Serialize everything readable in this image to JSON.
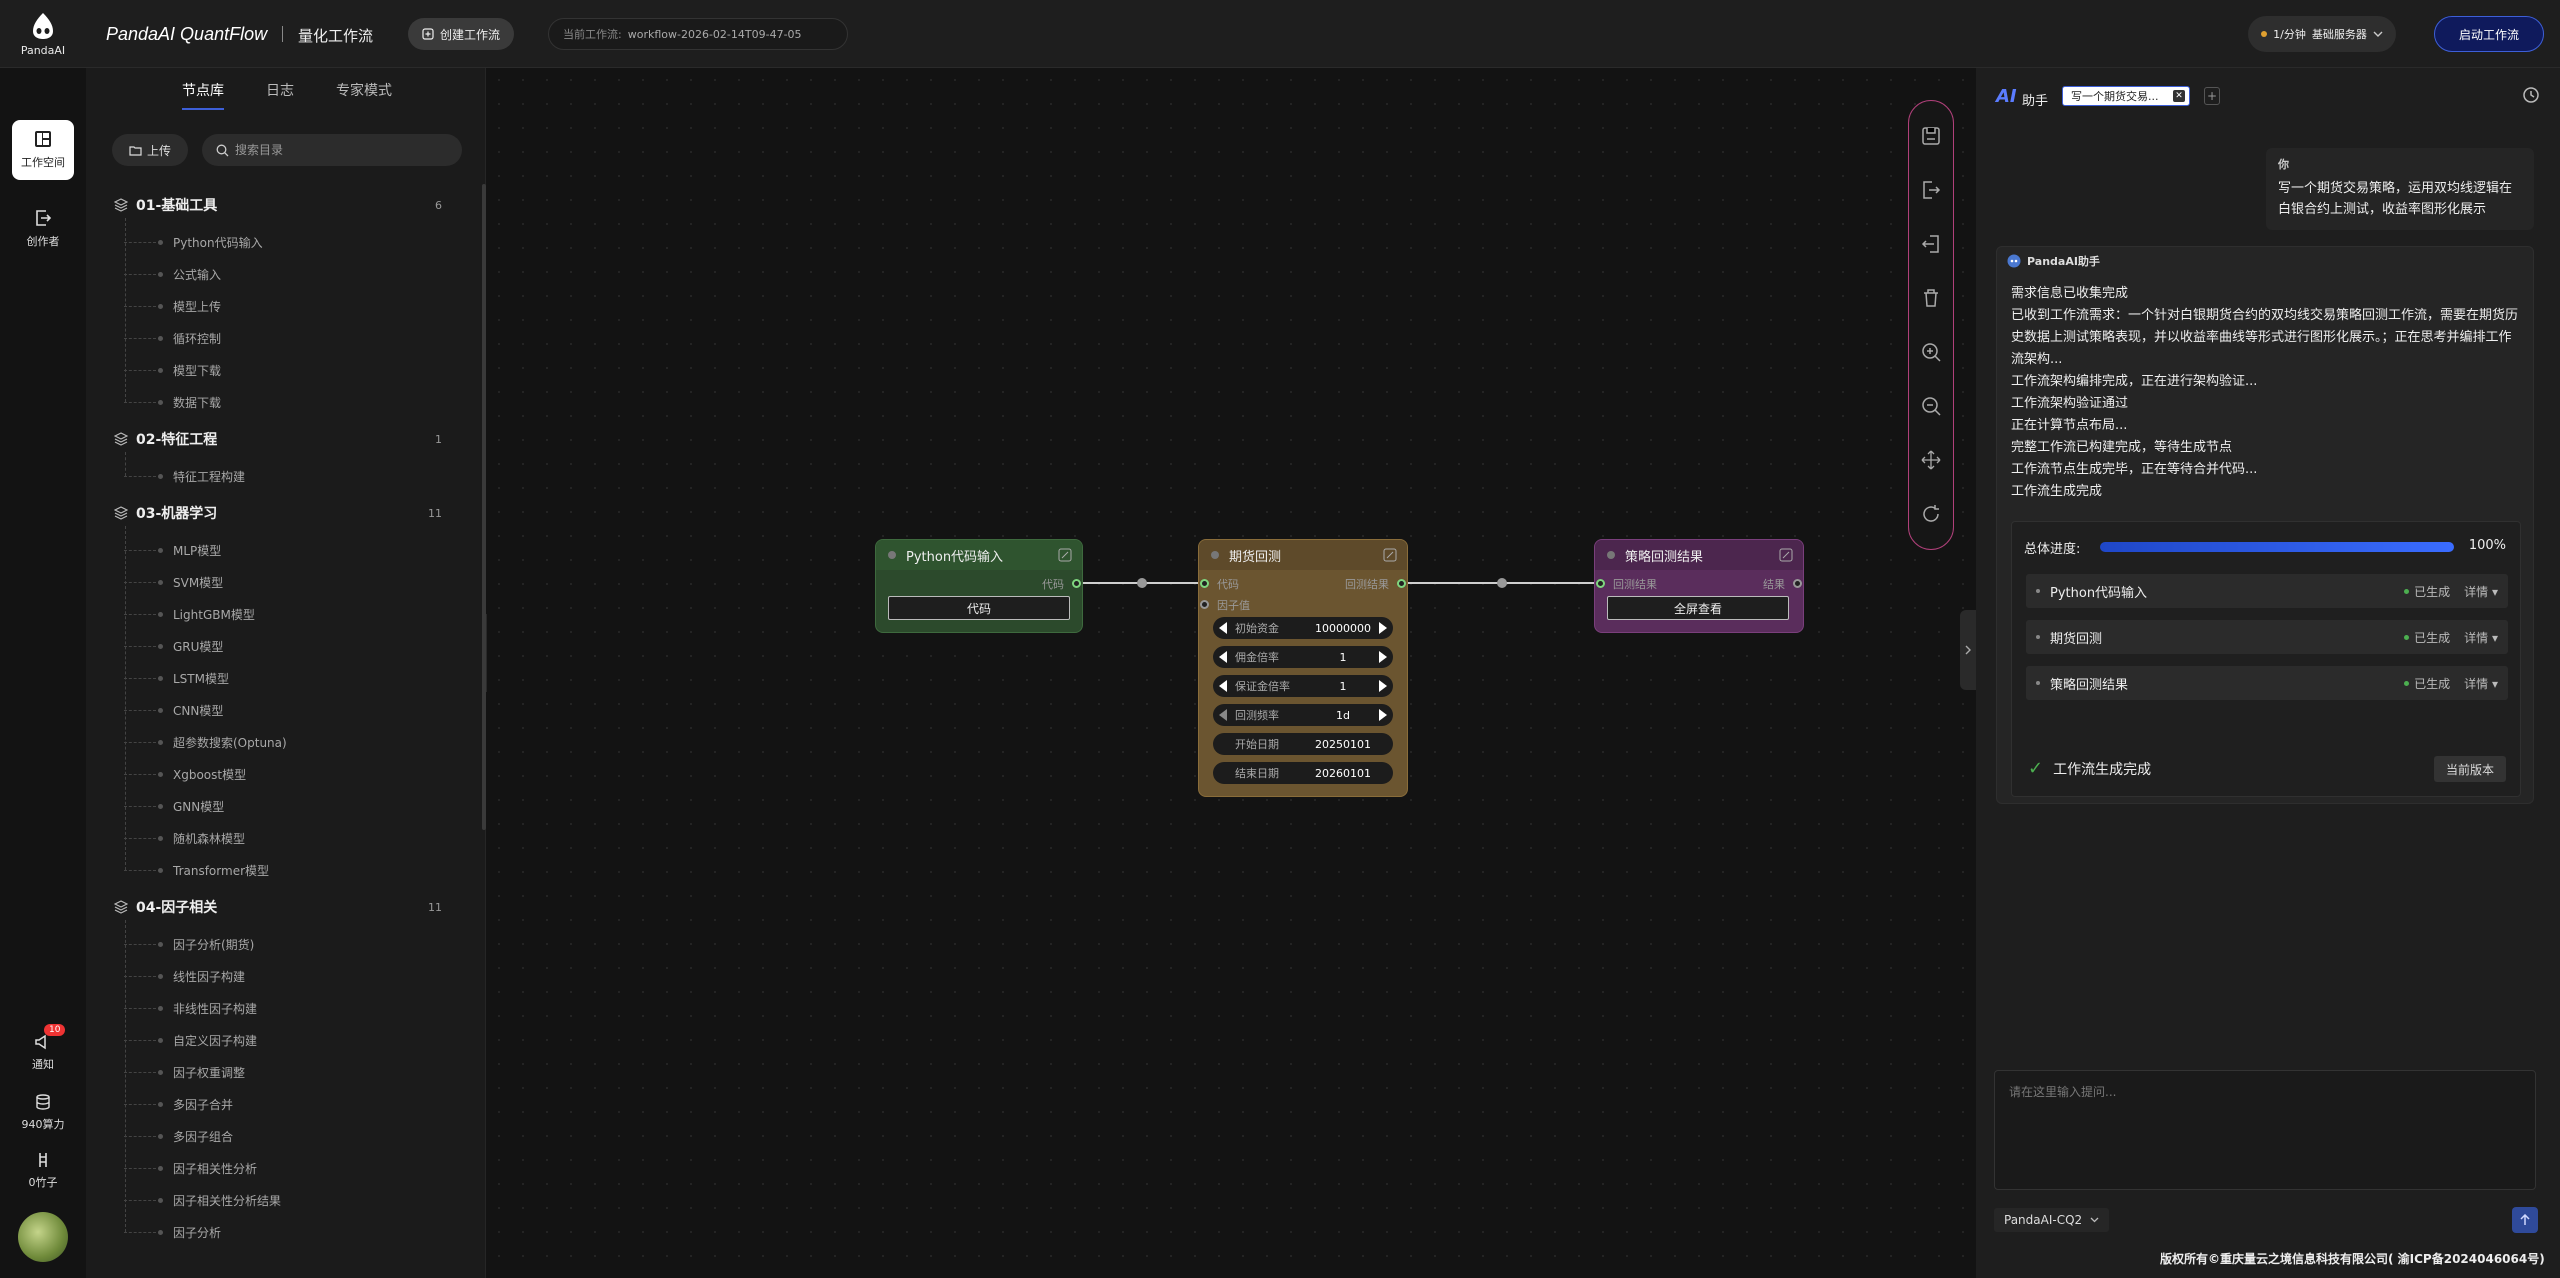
{
  "header": {
    "logo_label": "PandaAI",
    "app_title": "PandaAI QuantFlow",
    "app_subtitle": "量化工作流",
    "create_button": "创建工作流",
    "current_workflow_label": "当前工作流:",
    "current_workflow_value": "workflow-2026-02-14T09-47-05",
    "server_rate": "1/分钟",
    "server_name": "基础服务器",
    "start_button": "启动工作流"
  },
  "rail": {
    "workspace": "工作空间",
    "creator": "创作者",
    "notify": "通知",
    "notify_badge": "10",
    "compute": "940算力",
    "bamboo": "0竹子"
  },
  "library": {
    "tabs": [
      "节点库",
      "日志",
      "专家模式"
    ],
    "upload_label": "上传",
    "search_placeholder": "搜索目录",
    "categories": [
      {
        "name": "01-基础工具",
        "count": "6",
        "items": [
          "Python代码输入",
          "公式输入",
          "模型上传",
          "循环控制",
          "模型下载",
          "数据下载"
        ]
      },
      {
        "name": "02-特征工程",
        "count": "1",
        "items": [
          "特征工程构建"
        ]
      },
      {
        "name": "03-机器学习",
        "count": "11",
        "items": [
          "MLP模型",
          "SVM模型",
          "LightGBM模型",
          "GRU模型",
          "LSTM模型",
          "CNN模型",
          "超参数搜索(Optuna)",
          "Xgboost模型",
          "GNN模型",
          "随机森林模型",
          "Transformer模型"
        ]
      },
      {
        "name": "04-因子相关",
        "count": "11",
        "items": [
          "因子分析(期货)",
          "线性因子构建",
          "非线性因子构建",
          "自定义因子构建",
          "因子权重调整",
          "多因子合并",
          "多因子组合",
          "因子相关性分析",
          "因子相关性分析结果",
          "因子分析"
        ]
      }
    ]
  },
  "nodes": {
    "python": {
      "title": "Python代码输入",
      "out_label": "代码",
      "button": "代码"
    },
    "futures": {
      "title": "期货回测",
      "in_label": "代码",
      "in2_label": "因子值",
      "out_label": "回测结果",
      "params": [
        {
          "name": "初始资金",
          "value": "10000000"
        },
        {
          "name": "佣金倍率",
          "value": "1"
        },
        {
          "name": "保证金倍率",
          "value": "1"
        },
        {
          "name": "回测频率",
          "value": "1d"
        },
        {
          "name": "开始日期",
          "value": "20250101"
        },
        {
          "name": "结束日期",
          "value": "20260101"
        }
      ]
    },
    "result": {
      "title": "策略回测结果",
      "in_label": "回测结果",
      "out_label": "结果",
      "button": "全屏查看"
    }
  },
  "assistant": {
    "title": "助手",
    "tab_label": "写一个期货交易...",
    "user_label": "你",
    "user_message": "写一个期货交易策略，运用双均线逻辑在白银合约上测试，收益率图形化展示",
    "ai_label": "PandaAI助手",
    "ai_lines": [
      "需求信息已收集完成",
      "已收到工作流需求：一个针对白银期货合约的双均线交易策略回测工作流，需要在期货历史数据上测试策略表现，并以收益率曲线等形式进行图形化展示。；正在思考并编排工作流架构...",
      "工作流架构编排完成，正在进行架构验证...",
      "工作流架构验证通过",
      "正在计算节点布局...",
      "完整工作流已构建完成，等待生成节点",
      "工作流节点生成完毕，正在等待合并代码...",
      "工作流生成完成"
    ],
    "progress_label": "总体进度:",
    "progress_value": "100%",
    "progress_fraction": 1.0,
    "steps": [
      {
        "name": "Python代码输入",
        "status": "已生成",
        "detail": "详情 ▾"
      },
      {
        "name": "期货回测",
        "status": "已生成",
        "detail": "详情 ▾"
      },
      {
        "name": "策略回测结果",
        "status": "已生成",
        "detail": "详情 ▾"
      }
    ],
    "done_text": "工作流生成完成",
    "version_button": "当前版本",
    "input_placeholder": "请在这里输入提问...",
    "model": "PandaAI-CQ2"
  },
  "footer": "版权所有©重庆量云之境信息科技有限公司( 渝ICP备2024046064号)",
  "colors": {
    "accent": "#3d5fd8",
    "python_node": "#2c4a2c",
    "futures_node": "#6b5530",
    "result_node": "#5a2d5c",
    "success": "#4caf50"
  }
}
